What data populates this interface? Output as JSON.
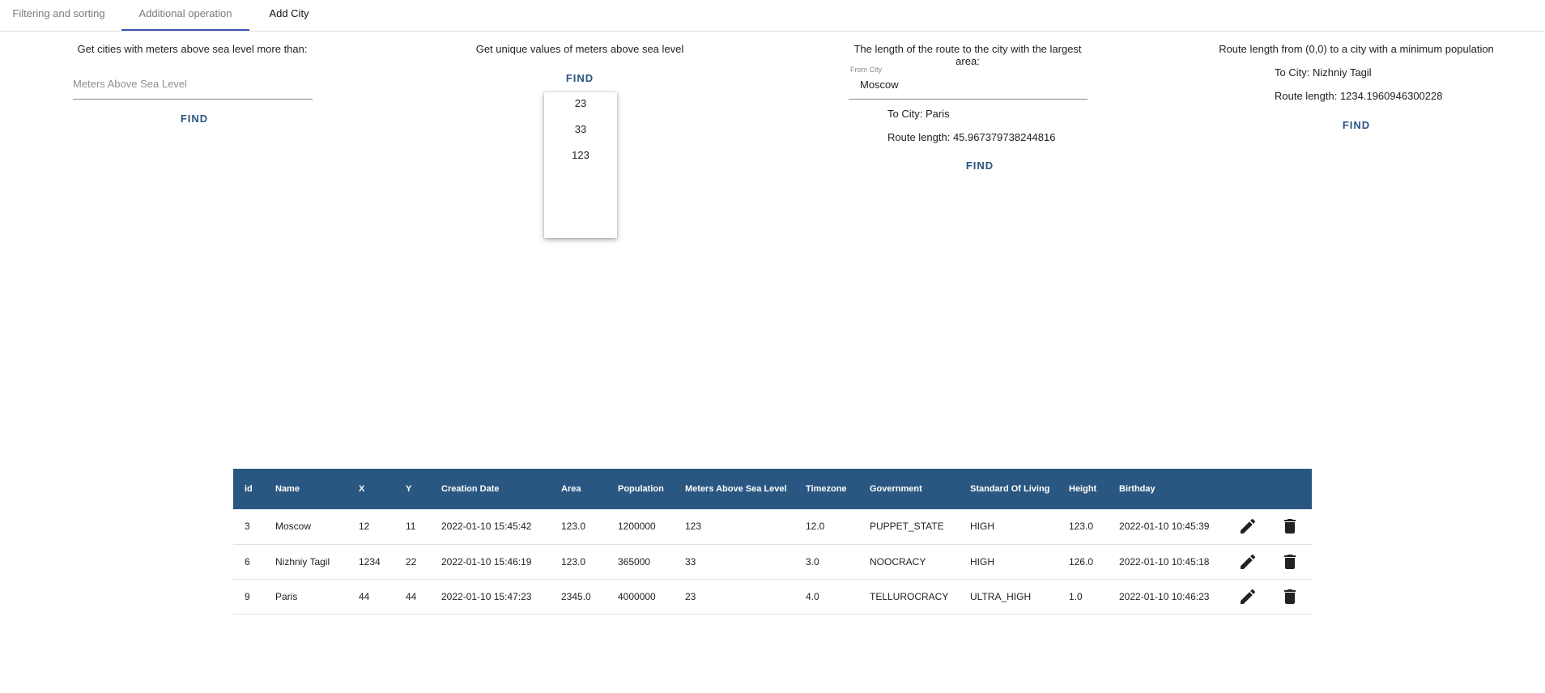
{
  "tabs": [
    {
      "label": "Filtering and sorting"
    },
    {
      "label": "Additional operation"
    },
    {
      "label": "Add City"
    }
  ],
  "panel1": {
    "title": "Get cities with meters above sea level more than:",
    "input_placeholder": "Meters Above Sea Level",
    "input_value": "",
    "find_label": "FIND"
  },
  "panel2": {
    "title": "Get unique values of meters above sea level",
    "find_label": "FIND",
    "options": [
      "23",
      "33",
      "123"
    ]
  },
  "panel3": {
    "title": "The length of the route to the city with the largest area:",
    "from_label": "From City",
    "from_value": "Moscow",
    "to_city": "To City: Paris",
    "route_length": "Route length: 45.967379738244816",
    "find_label": "FIND"
  },
  "panel4": {
    "title": "Route length from (0,0) to a city with a minimum population",
    "to_city": "To City: Nizhniy Tagil",
    "route_length": "Route length: 1234.1960946300228",
    "find_label": "FIND"
  },
  "table": {
    "headers": [
      "id",
      "Name",
      "X",
      "Y",
      "Creation Date",
      "Area",
      "Population",
      "Meters Above Sea Level",
      "Timezone",
      "Government",
      "Standard Of Living",
      "Height",
      "Birthday"
    ],
    "rows": [
      [
        "3",
        "Moscow",
        "12",
        "11",
        "2022-01-10 15:45:42",
        "123.0",
        "1200000",
        "123",
        "12.0",
        "PUPPET_STATE",
        "HIGH",
        "123.0",
        "2022-01-10 10:45:39"
      ],
      [
        "6",
        "Nizhniy Tagil",
        "1234",
        "22",
        "2022-01-10 15:46:19",
        "123.0",
        "365000",
        "33",
        "3.0",
        "NOOCRACY",
        "HIGH",
        "126.0",
        "2022-01-10 10:45:18"
      ],
      [
        "9",
        "Paris",
        "44",
        "44",
        "2022-01-10 15:47:23",
        "2345.0",
        "4000000",
        "23",
        "4.0",
        "TELLUROCRACY",
        "ULTRA_HIGH",
        "1.0",
        "2022-01-10 10:46:23"
      ]
    ],
    "row_icons": [
      "pencil-icon",
      "trash-icon"
    ]
  },
  "colors": {
    "header_bg": "#2a5781",
    "accent": "#3f51b5",
    "button_text": "#2a567e"
  }
}
